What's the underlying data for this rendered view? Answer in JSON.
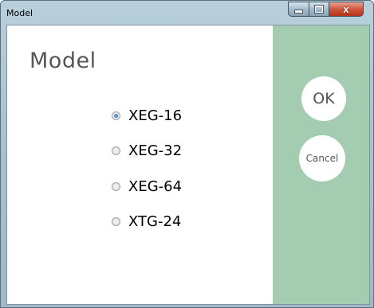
{
  "window": {
    "title": "Model"
  },
  "dialog": {
    "heading": "Model",
    "options": [
      {
        "label": "XEG-16",
        "checked": true
      },
      {
        "label": "XEG-32",
        "checked": false
      },
      {
        "label": "XEG-64",
        "checked": false
      },
      {
        "label": "XTG-24",
        "checked": false
      }
    ],
    "ok_label": "OK",
    "cancel_label": "Cancel"
  },
  "controls": {
    "close_glyph": "x"
  },
  "colors": {
    "side_panel": "#a3ccb1",
    "heading": "#555555",
    "radio_selected": "#2a6fc0"
  }
}
